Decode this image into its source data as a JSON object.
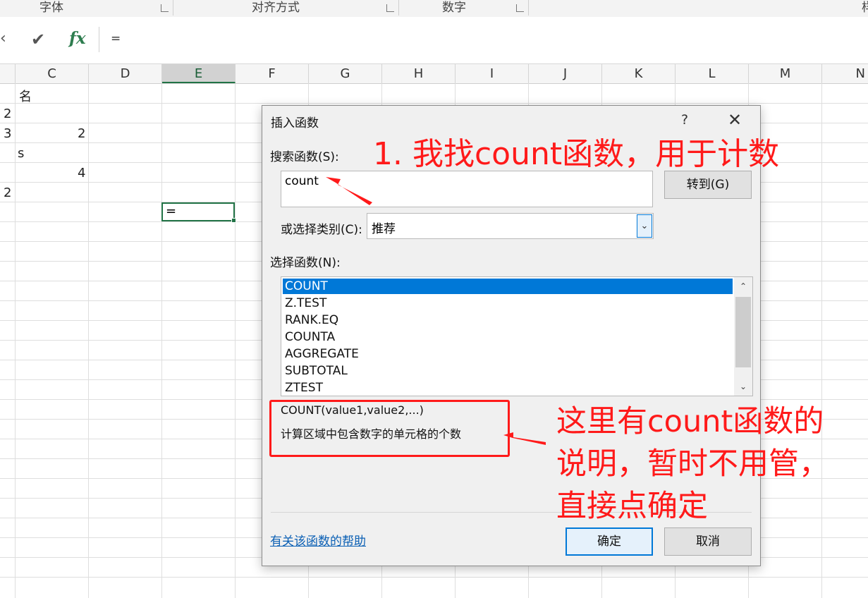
{
  "ribbon": {
    "groups": [
      {
        "label": "字体"
      },
      {
        "label": "对齐方式"
      },
      {
        "label": "数字"
      },
      {
        "label": "样"
      }
    ]
  },
  "formula_bar": {
    "cancel_icon": "close-icon",
    "enter_icon": "check-icon",
    "fx_label": "fx",
    "content": "="
  },
  "columns": [
    "C",
    "D",
    "E",
    "F",
    "G",
    "H",
    "I",
    "J",
    "K",
    "L",
    "M",
    "N"
  ],
  "selected_column": "E",
  "cells": [
    {
      "text": "名"
    },
    {
      "text": "2"
    },
    {
      "text": "3"
    },
    {
      "text": "2"
    },
    {
      "text": "s"
    },
    {
      "text": "4"
    },
    {
      "text": "2"
    }
  ],
  "active_cell": {
    "content": "="
  },
  "dialog": {
    "title": "插入函数",
    "help_icon": "?",
    "close_icon": "✕",
    "search_label": "搜索函数(S):",
    "search_value": "count",
    "goto_button": "转到(G)",
    "category_label": "或选择类别(C):",
    "category_value": "推荐",
    "function_list_label": "选择函数(N):",
    "functions": [
      "COUNT",
      "Z.TEST",
      "RANK.EQ",
      "COUNTA",
      "AGGREGATE",
      "SUBTOTAL",
      "ZTEST"
    ],
    "selected_function": "COUNT",
    "signature": "COUNT(value1,value2,...)",
    "description": "计算区域中包含数字的单元格的个数",
    "help_link": "有关该函数的帮助",
    "ok_button": "确定",
    "cancel_button": "取消"
  },
  "annotations": {
    "step1": "1. 我找count函数，用于计数",
    "note_lines": [
      "这里有count函数的",
      "说明，暂时不用管，",
      "直接点确定"
    ],
    "color": "#ff1a1a"
  }
}
